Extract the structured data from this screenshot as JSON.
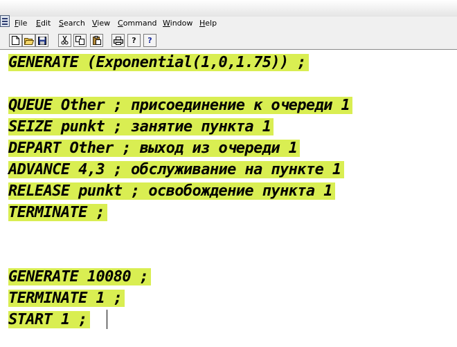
{
  "menu": [
    "File",
    "Edit",
    "Search",
    "View",
    "Command",
    "Window",
    "Help"
  ],
  "toolbar": {
    "buttons": [
      {
        "icon": "new-document-icon"
      },
      {
        "icon": "open-folder-icon"
      },
      {
        "icon": "save-disk-icon"
      },
      {
        "icon": "cut-scissors-icon"
      },
      {
        "icon": "copy-icon"
      },
      {
        "icon": "paste-icon"
      },
      {
        "icon": "print-icon"
      },
      {
        "icon": "help-icon",
        "label": "?"
      },
      {
        "icon": "context-help-icon",
        "label": "?"
      }
    ]
  },
  "editor": {
    "highlight_color": "#d9ee52",
    "lines": [
      "GENERATE (Exponential(1,0,1.75)) ;",
      "",
      "QUEUE Other ; присоединение к очереди 1",
      "SEIZE punkt ; занятие пункта 1",
      "DEPART Other ; выход из очереди 1",
      "ADVANCE 4,3 ; обслуживание на пункте 1",
      "RELEASE punkt ; освобождение пункта 1",
      "TERMINATE ;",
      "",
      "",
      "",
      "GENERATE 10080 ;",
      "TERMINATE 1 ;",
      "START 1 ;"
    ]
  }
}
